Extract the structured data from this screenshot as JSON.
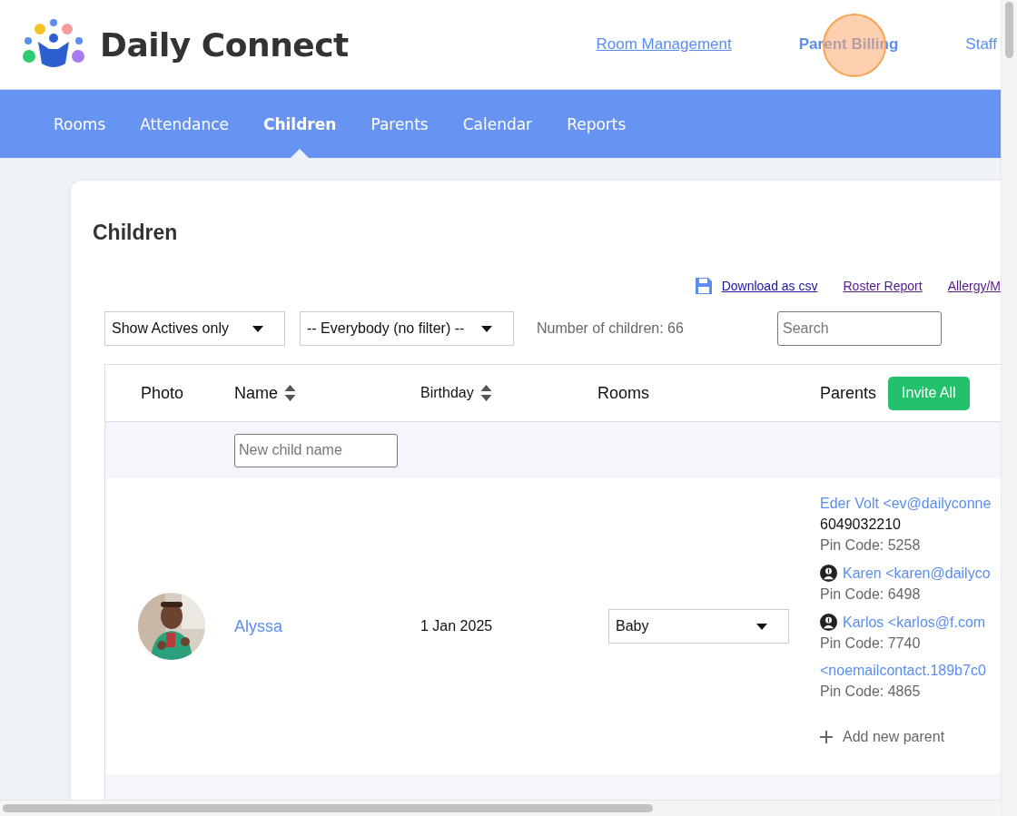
{
  "header": {
    "logo_text": "Daily Connect",
    "links": [
      {
        "label": "Room Management",
        "selected": false,
        "underlined": true
      },
      {
        "label": "Parent Billing",
        "selected": true,
        "underlined": false
      },
      {
        "label": "Staff",
        "selected": false,
        "underlined": false
      }
    ]
  },
  "nav": [
    {
      "label": "Rooms",
      "selected": false
    },
    {
      "label": "Attendance",
      "selected": false
    },
    {
      "label": "Children",
      "selected": true
    },
    {
      "label": "Parents",
      "selected": false
    },
    {
      "label": "Calendar",
      "selected": false
    },
    {
      "label": "Reports",
      "selected": false
    }
  ],
  "page_title": "Children",
  "actions": [
    {
      "label": "Download as csv",
      "kind": "download",
      "visited": false
    },
    {
      "label": "Roster Report",
      "kind": "link",
      "visited": true
    },
    {
      "label": "Allergy/M",
      "kind": "link",
      "visited": true
    }
  ],
  "filters": {
    "status": "Show Actives only",
    "group": "-- Everybody (no filter) --",
    "count": "Number of children: 66",
    "search": {
      "placeholder": "Search"
    }
  },
  "table": {
    "columns": [
      {
        "label": "Photo",
        "sortable": false
      },
      {
        "label": "Name",
        "sortable": true
      },
      {
        "label": "Birthday",
        "sortable": true
      },
      {
        "label": "Rooms",
        "sortable": false
      },
      {
        "label": "Parents",
        "sortable": false
      }
    ],
    "invite_button": "Invite All",
    "new_child": {
      "placeholder": "New child name"
    },
    "rows": [
      {
        "photo": {
          "kind": "picture"
        },
        "name": "Alyssa",
        "birthday": "1 Jan 2025",
        "room": "Baby",
        "add_parent": "Add new parent",
        "parents": [
          {
            "kind": "contact",
            "name": "Eder Volt <ev@dailyconne",
            "phone": "6049032210",
            "pin": "Pin Code: 5258"
          },
          {
            "kind": "billing",
            "name": "Karen <karen@dailyco",
            "pin": "Pin Code: 6498"
          },
          {
            "kind": "billing",
            "name": "Karlos <karlos@f.com",
            "pin": "Pin Code: 7740"
          },
          {
            "kind": "contact",
            "name": "<noemailcontact.189b7c0",
            "pin": "Pin Code: 4865"
          }
        ]
      }
    ]
  }
}
